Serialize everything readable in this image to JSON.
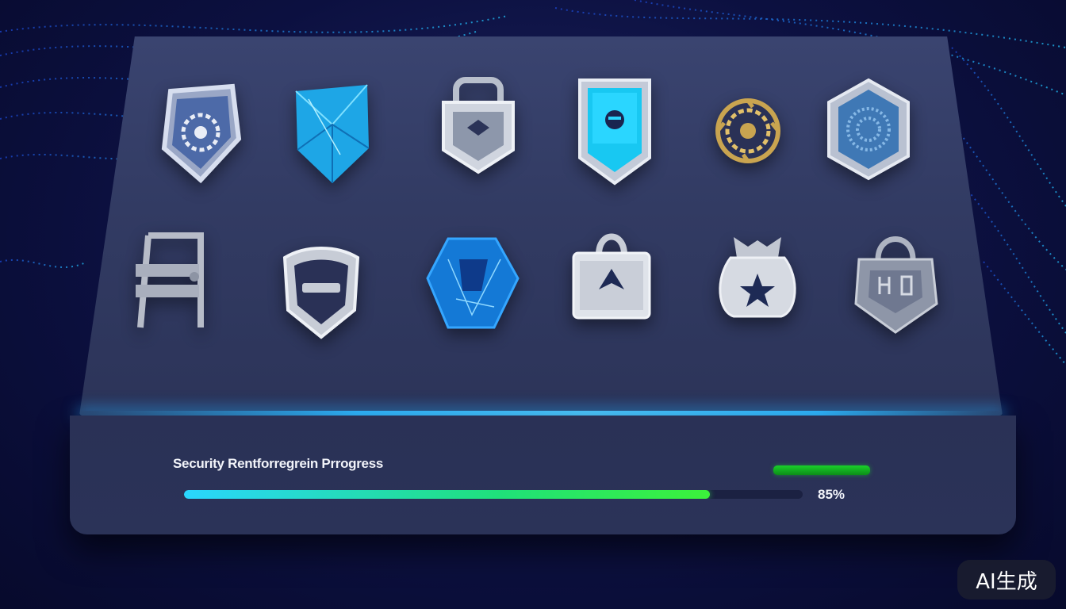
{
  "badges": [
    {
      "name": "gear-shield-icon",
      "row": 1
    },
    {
      "name": "crystal-shield-icon",
      "row": 1
    },
    {
      "name": "lock-shield-icon",
      "row": 1
    },
    {
      "name": "glowing-tag-shield-icon",
      "row": 1
    },
    {
      "name": "gold-emblem-icon",
      "row": 1
    },
    {
      "name": "hexagon-emblem-icon",
      "row": 1
    },
    {
      "name": "barrier-frame-icon",
      "row": 2
    },
    {
      "name": "minus-shield-icon",
      "row": 2
    },
    {
      "name": "crystal-hexagon-icon",
      "row": 2
    },
    {
      "name": "arrow-bag-icon",
      "row": 2
    },
    {
      "name": "star-sack-icon",
      "row": 2
    },
    {
      "name": "circuit-lock-icon",
      "row": 2
    }
  ],
  "progress": {
    "label": "Security Rentforregrein Prrogress",
    "value_text": "85%",
    "fraction": 0.85
  },
  "watermark": {
    "text": "AI生成"
  },
  "colors": {
    "accent_glow": "#2fb6ff",
    "progress_start": "#2ad6ff",
    "progress_end": "#3cf23a",
    "panel": "#323b63"
  }
}
